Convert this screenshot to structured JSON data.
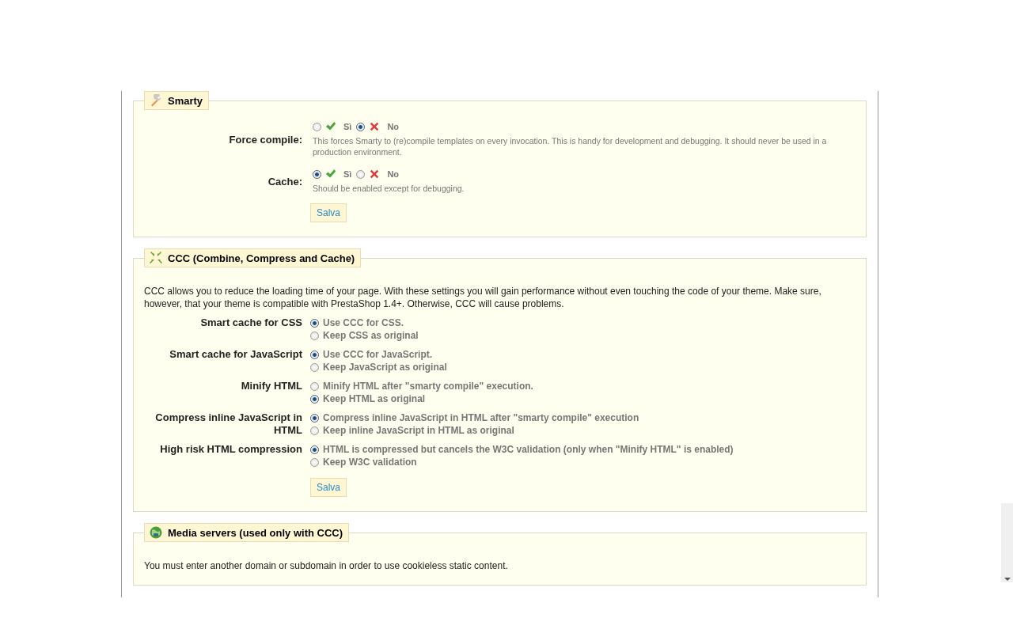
{
  "sections": [
    {
      "title": "Smarty",
      "fields": [
        {
          "kind": "yesno",
          "label": "Force compile:",
          "options": [
            {
              "label": "Sì",
              "kind": "yes",
              "selected": false
            },
            {
              "label": "No",
              "kind": "no",
              "selected": true
            }
          ],
          "hint": "This forces Smarty to (re)compile templates on every invocation. This is handy for development and debugging. It should never be used in a production environment."
        },
        {
          "kind": "yesno",
          "label": "Cache:",
          "options": [
            {
              "label": "Sì",
              "kind": "yes",
              "selected": true
            },
            {
              "label": "No",
              "kind": "no",
              "selected": false
            }
          ],
          "hint": "Should be enabled except for debugging."
        }
      ],
      "save_button": "Salva"
    },
    {
      "title": "CCC (Combine, Compress and Cache)",
      "intro": "CCC allows you to reduce the loading time of your page. With these settings you will gain performance without even touching the code of your theme. Make sure, however, that your theme is compatible with PrestaShop 1.4+. Otherwise, CCC will cause problems.",
      "fields": [
        {
          "kind": "list",
          "label": "Smart cache for CSS",
          "options": [
            {
              "label": "Use CCC for CSS.",
              "selected": true
            },
            {
              "label": "Keep CSS as original",
              "selected": false
            }
          ]
        },
        {
          "kind": "list",
          "label": "Smart cache for JavaScript",
          "options": [
            {
              "label": "Use CCC for JavaScript.",
              "selected": true
            },
            {
              "label": "Keep JavaScript as original",
              "selected": false
            }
          ]
        },
        {
          "kind": "list",
          "label": "Minify HTML",
          "options": [
            {
              "label": "Minify HTML after \"smarty compile\" execution.",
              "selected": false
            },
            {
              "label": "Keep HTML as original",
              "selected": true
            }
          ]
        },
        {
          "kind": "list",
          "label": "Compress inline JavaScript in HTML",
          "options": [
            {
              "label": "Compress inline JavaScript in HTML after \"smarty compile\" execution",
              "selected": true
            },
            {
              "label": "Keep inline JavaScript in HTML as original",
              "selected": false
            }
          ]
        },
        {
          "kind": "list",
          "label": "High risk HTML compression",
          "options": [
            {
              "label": "HTML is compressed but cancels the W3C validation (only when \"Minify HTML\" is enabled)",
              "selected": true
            },
            {
              "label": "Keep W3C validation",
              "selected": false
            }
          ]
        }
      ],
      "save_button": "Salva"
    },
    {
      "title": "Media servers (used only with CCC)",
      "intro": "You must enter another domain or subdomain in order to use cookieless static content."
    }
  ]
}
